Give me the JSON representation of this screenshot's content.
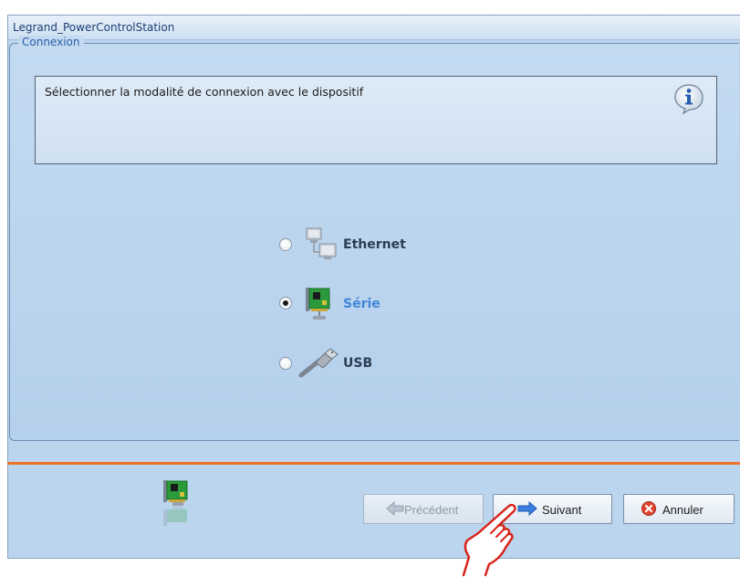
{
  "window": {
    "title": "Legrand_PowerControlStation"
  },
  "group": {
    "legend": "Connexion"
  },
  "info": {
    "message": "Sélectionner la modalité de connexion avec le dispositif",
    "icon": "info-icon"
  },
  "options": [
    {
      "label": "Ethernet",
      "icon": "network-computers-icon",
      "selected": false
    },
    {
      "label": "Série",
      "icon": "serial-card-icon",
      "selected": true
    },
    {
      "label": "USB",
      "icon": "usb-cable-icon",
      "selected": false
    }
  ],
  "buttons": {
    "previous": {
      "label": "Précédent",
      "icon": "arrow-left-icon",
      "enabled": false
    },
    "next": {
      "label": "Suivant",
      "icon": "arrow-right-icon",
      "enabled": true
    },
    "cancel": {
      "label": "Annuler",
      "icon": "cancel-x-icon",
      "enabled": true
    }
  },
  "colors": {
    "accent_separator": "#f0702a",
    "selected_option": "#3f86d6",
    "window_bg": "#bcd5ee"
  }
}
